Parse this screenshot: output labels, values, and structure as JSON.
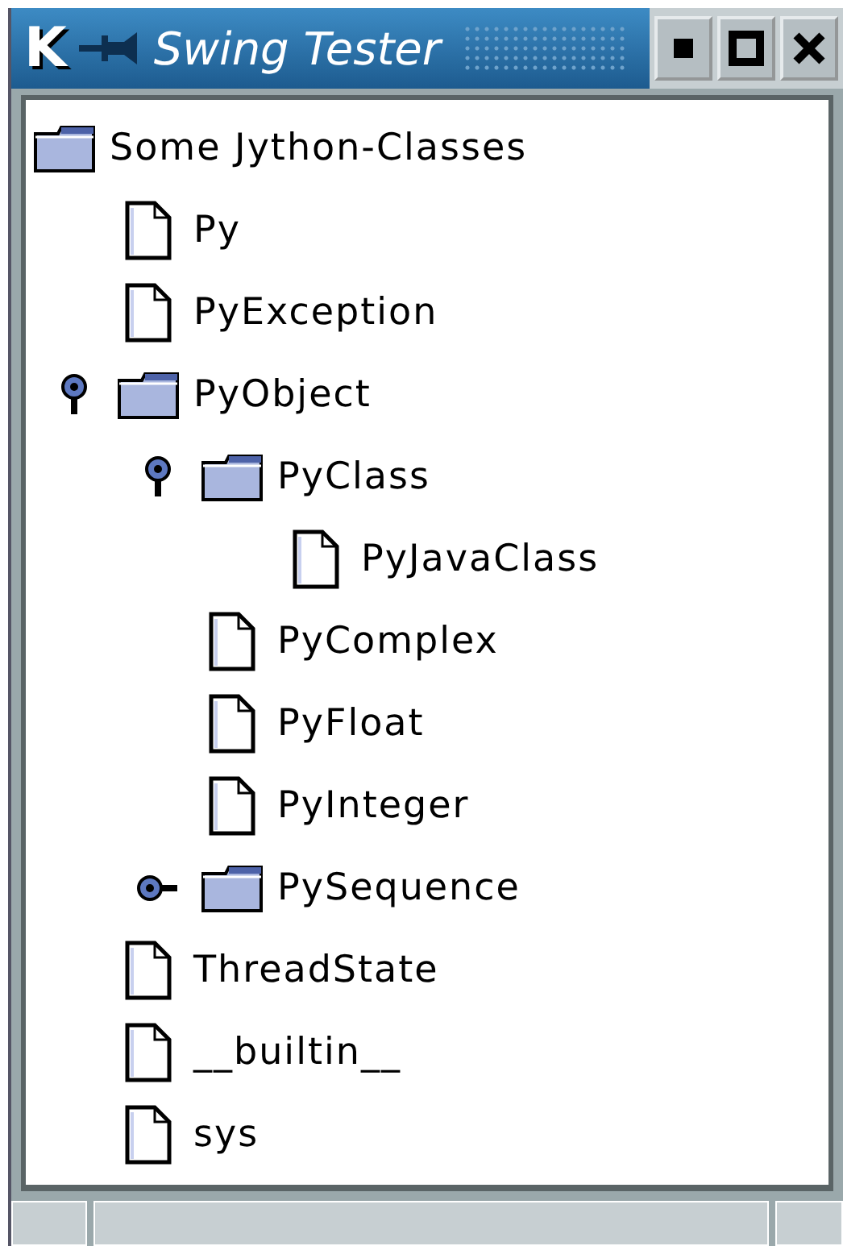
{
  "window": {
    "logo": "K",
    "title": "Swing Tester"
  },
  "tree": [
    {
      "label": "Some Jython-Classes",
      "kind": "folder",
      "children": [
        {
          "label": "Py",
          "kind": "file"
        },
        {
          "label": "PyException",
          "kind": "file"
        },
        {
          "label": "PyObject",
          "kind": "folder",
          "expanded": true,
          "children": [
            {
              "label": "PyClass",
              "kind": "folder",
              "expanded": true,
              "children": [
                {
                  "label": "PyJavaClass",
                  "kind": "file"
                }
              ]
            },
            {
              "label": "PyComplex",
              "kind": "file"
            },
            {
              "label": "PyFloat",
              "kind": "file"
            },
            {
              "label": "PyInteger",
              "kind": "file"
            },
            {
              "label": "PySequence",
              "kind": "folder",
              "expanded": false
            }
          ]
        },
        {
          "label": "ThreadState",
          "kind": "file"
        },
        {
          "label": "__builtin__",
          "kind": "file"
        },
        {
          "label": "sys",
          "kind": "file"
        }
      ]
    }
  ]
}
